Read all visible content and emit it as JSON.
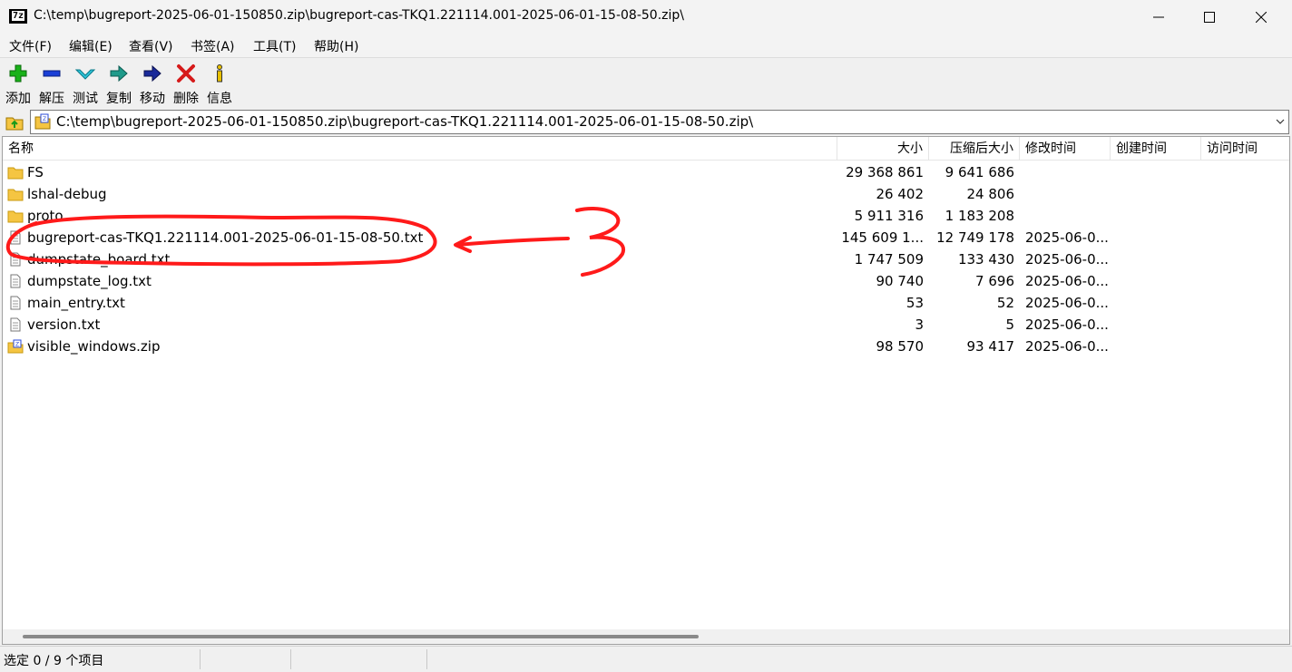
{
  "window": {
    "title": "C:\\temp\\bugreport-2025-06-01-150850.zip\\bugreport-cas-TKQ1.221114.001-2025-06-01-15-08-50.zip\\",
    "app_icon_text": "7z"
  },
  "menu": [
    "文件(F)",
    "编辑(E)",
    "查看(V)",
    "书签(A)",
    "工具(T)",
    "帮助(H)"
  ],
  "toolbar": {
    "add": "添加",
    "extract": "解压",
    "test": "测试",
    "copy": "复制",
    "move": "移动",
    "delete": "删除",
    "info": "信息"
  },
  "address": {
    "path": "C:\\temp\\bugreport-2025-06-01-150850.zip\\bugreport-cas-TKQ1.221114.001-2025-06-01-15-08-50.zip\\"
  },
  "columns": {
    "name": "名称",
    "size": "大小",
    "packed": "压缩后大小",
    "modified": "修改时间",
    "created": "创建时间",
    "accessed": "访问时间"
  },
  "files": [
    {
      "type": "folder",
      "name": "FS",
      "size": "29 368 861",
      "packed": "9 641 686",
      "modified": ""
    },
    {
      "type": "folder",
      "name": "lshal-debug",
      "size": "26 402",
      "packed": "24 806",
      "modified": ""
    },
    {
      "type": "folder",
      "name": "proto",
      "size": "5 911 316",
      "packed": "1 183 208",
      "modified": ""
    },
    {
      "type": "file",
      "name": "bugreport-cas-TKQ1.221114.001-2025-06-01-15-08-50.txt",
      "size": "145 609 1...",
      "packed": "12 749 178",
      "modified": "2025-06-0..."
    },
    {
      "type": "file",
      "name": "dumpstate_board.txt",
      "size": "1 747 509",
      "packed": "133 430",
      "modified": "2025-06-0..."
    },
    {
      "type": "file",
      "name": "dumpstate_log.txt",
      "size": "90 740",
      "packed": "7 696",
      "modified": "2025-06-0..."
    },
    {
      "type": "file",
      "name": "main_entry.txt",
      "size": "53",
      "packed": "52",
      "modified": "2025-06-0..."
    },
    {
      "type": "file",
      "name": "version.txt",
      "size": "3",
      "packed": "5",
      "modified": "2025-06-0..."
    },
    {
      "type": "zip",
      "name": "visible_windows.zip",
      "size": "98 570",
      "packed": "93 417",
      "modified": "2025-06-0..."
    }
  ],
  "status": {
    "selection": "选定 0 / 9 个项目"
  },
  "colors": {
    "annotation": "#ff1a1a",
    "folder": "#f5c542"
  }
}
